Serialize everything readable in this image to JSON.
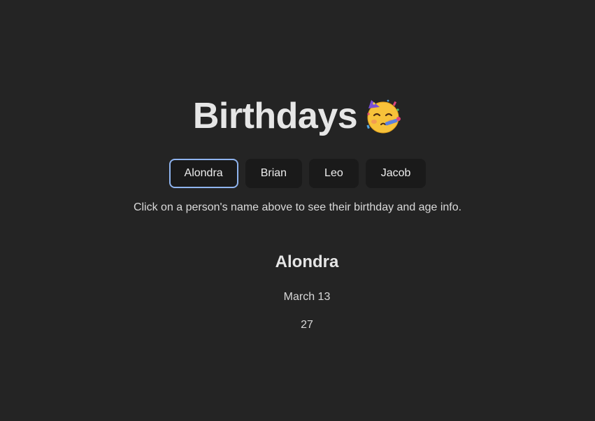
{
  "header": {
    "title": "Birthdays",
    "title_icon": "partying-face-icon"
  },
  "tabs": [
    {
      "label": "Alondra",
      "active": true
    },
    {
      "label": "Brian",
      "active": false
    },
    {
      "label": "Leo",
      "active": false
    },
    {
      "label": "Jacob",
      "active": false
    }
  ],
  "instructions": "Click on a person's name above to see their birthday and age info.",
  "selected_person": {
    "name": "Alondra",
    "birthday": "March 13",
    "age": "27"
  },
  "colors": {
    "background": "#242424",
    "tab_background": "#1a1a1a",
    "active_tab_border": "#8fb4ef",
    "text": "#e6e6e6"
  }
}
